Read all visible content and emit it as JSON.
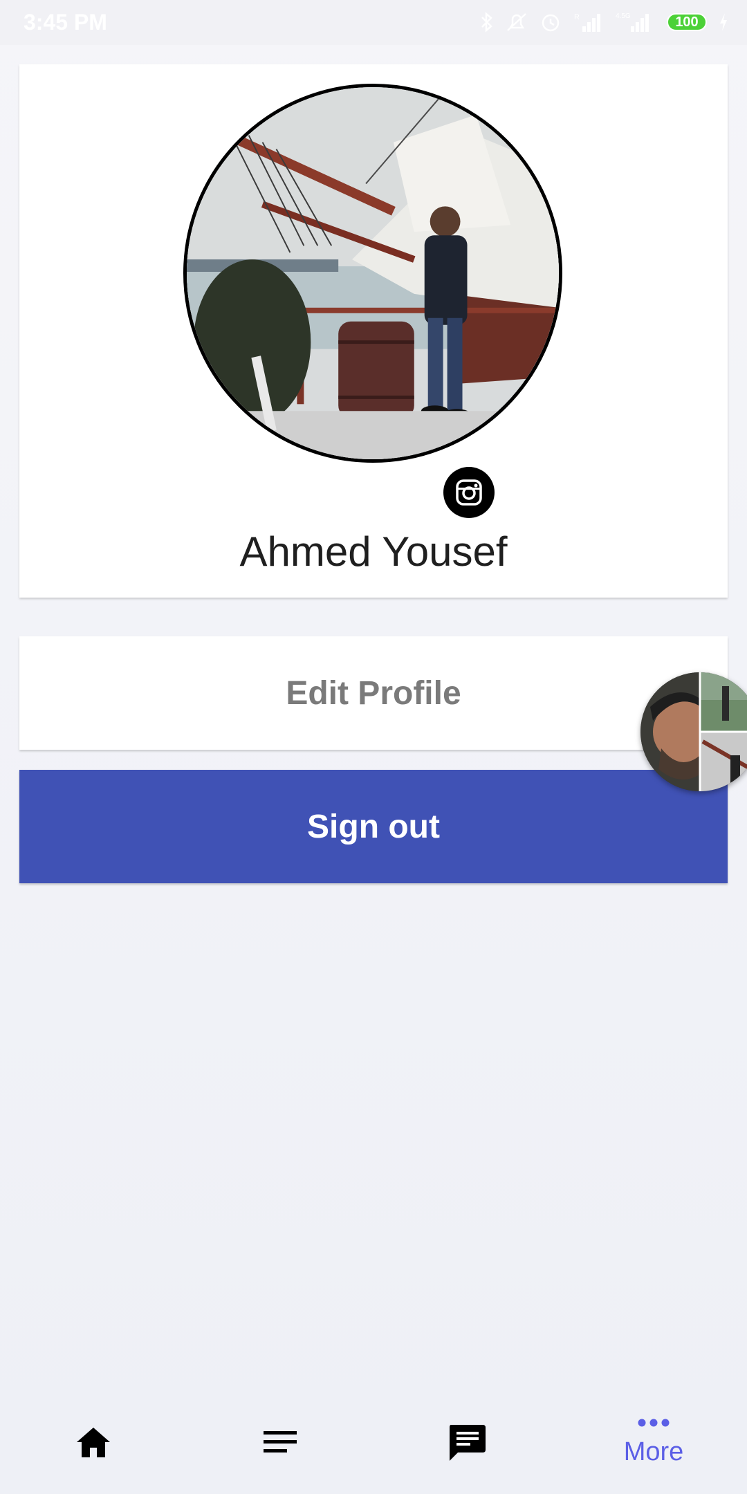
{
  "status_bar": {
    "time": "3:45 PM",
    "battery": "100",
    "icons": [
      "bluetooth-icon",
      "mute-icon",
      "alarm-icon",
      "signal-r-icon",
      "signal-4-5g-icon",
      "battery-icon",
      "charging-icon"
    ]
  },
  "profile": {
    "name": "Ahmed Yousef",
    "avatar_icon": "profile-photo",
    "social_icon": "instagram-icon"
  },
  "actions": {
    "edit_profile_label": "Edit Profile",
    "sign_out_label": "Sign out"
  },
  "chat_head": {
    "icon": "chat-head-avatar"
  },
  "bottom_nav": {
    "items": [
      {
        "icon": "home-icon",
        "label": ""
      },
      {
        "icon": "list-icon",
        "label": ""
      },
      {
        "icon": "chat-icon",
        "label": ""
      },
      {
        "icon": "more-icon",
        "label": "More"
      }
    ]
  },
  "colors": {
    "primary": "#4052b5",
    "nav_active": "#5b5fe6",
    "background": "#f2f2f7",
    "card": "#ffffff"
  }
}
